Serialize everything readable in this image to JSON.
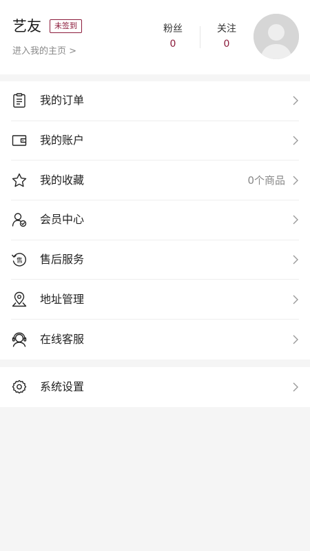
{
  "profile": {
    "username": "艺友",
    "checkin_badge": "未签到",
    "homepage_link": "进入我的主页 >",
    "fans_label": "粉丝",
    "fans_count": "0",
    "following_label": "关注",
    "following_count": "0"
  },
  "menu": {
    "orders": {
      "label": "我的订单",
      "icon": "clipboard-icon"
    },
    "account": {
      "label": "我的账户",
      "icon": "wallet-icon"
    },
    "favorites": {
      "label": "我的收藏",
      "extra": "0个商品",
      "icon": "star-icon"
    },
    "membership": {
      "label": "会员中心",
      "icon": "member-check-icon"
    },
    "after_sales": {
      "label": "售后服务",
      "icon_text": "售",
      "icon": "after-sales-icon"
    },
    "address": {
      "label": "地址管理",
      "icon": "location-pin-icon"
    },
    "customer_service": {
      "label": "在线客服",
      "icon": "headset-icon"
    }
  },
  "settings": {
    "label": "系统设置",
    "icon": "gear-icon"
  },
  "colors": {
    "accent": "#8b1a3a",
    "background": "#f5f5f5",
    "card": "#ffffff",
    "muted_text": "#888888",
    "divider": "#eeeeee"
  }
}
